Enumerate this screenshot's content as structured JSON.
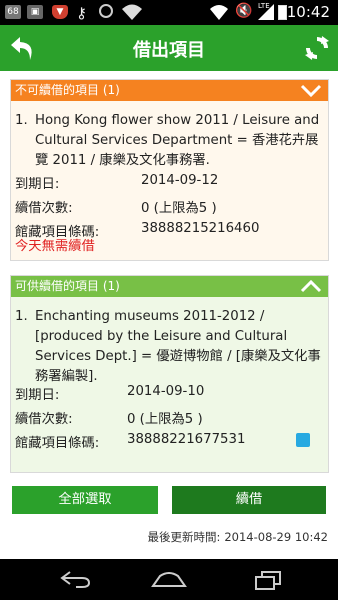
{
  "status_bar": {
    "badge": "68",
    "time": "10:42",
    "network": "LTE"
  },
  "header": {
    "title": "借出項目"
  },
  "non_renewable": {
    "heading": "不可續借的項目 (1)",
    "items": [
      {
        "index": "1.",
        "title": "Hong Kong flower show 2011 / Leisure and Cultural Services Department = 香港花卉展覽 2011 / 康樂及文化事務署.",
        "due_label": "到期日:",
        "due_value": "2014-09-12",
        "renew_label": "續借次數:",
        "renew_value": "0 (上限為5 )",
        "barcode_label": "館藏項目條碼:",
        "barcode_value": "38888215216460",
        "note": "今天無需續借"
      }
    ]
  },
  "renewable": {
    "heading": "可供續借的項目 (1)",
    "items": [
      {
        "index": "1.",
        "title": "Enchanting museums 2011-2012 / [produced by the Leisure and Cultural Services Dept.] = 優遊博物館 / [康樂及文化事務署編製].",
        "due_label": "到期日:",
        "due_value": "2014-09-10",
        "renew_label": "續借次數:",
        "renew_value": "0 (上限為5 )",
        "barcode_label": "館藏項目條碼:",
        "barcode_value": "38888221677531"
      }
    ]
  },
  "buttons": {
    "select_all": "全部選取",
    "renew": "續借"
  },
  "last_updated": {
    "label": "最後更新時間:",
    "value": "2014-08-29 10:42"
  },
  "colors": {
    "header_green": "#2ba12b",
    "orange_section": "#f58220",
    "green_section": "#78c046",
    "renew_button": "#1e7a1e",
    "alert_red": "#e02020",
    "checkbox_blue": "#27a9e1"
  }
}
